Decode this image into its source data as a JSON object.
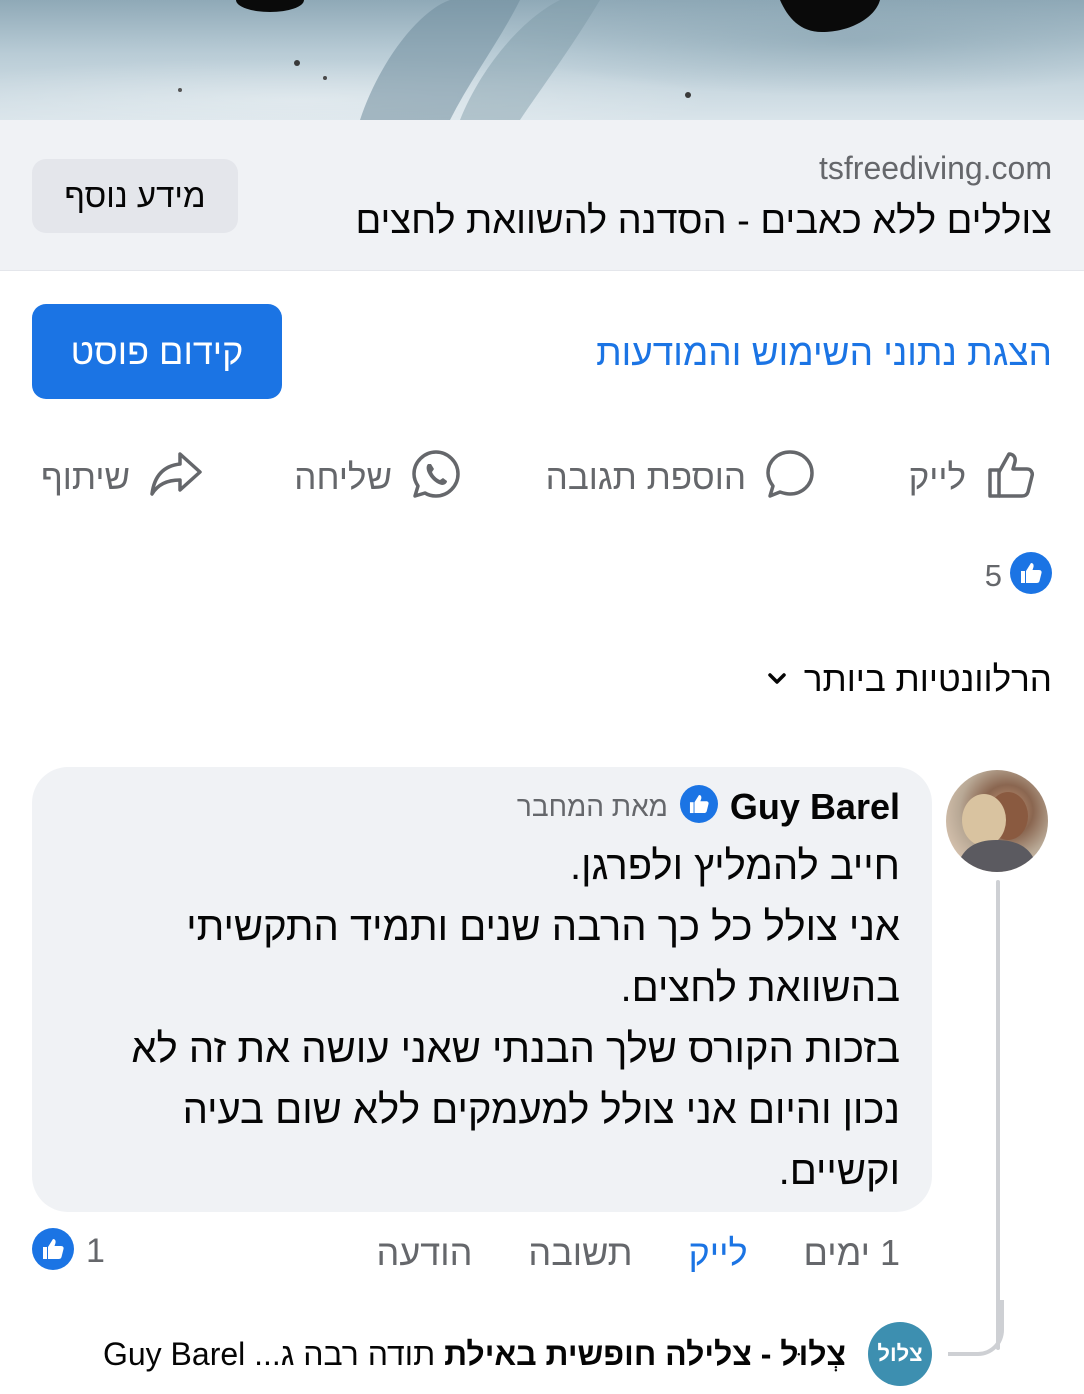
{
  "link_preview": {
    "domain": "tsfreediving.com",
    "title": "צוללים ללא כאבים - הסדנה להשוואת לחצים",
    "more_info_label": "מידע נוסף"
  },
  "promote": {
    "boost_label": "קידום פוסט",
    "insights_label": "הצגת נתוני השימוש והמודעות"
  },
  "actions": {
    "like_label": "לייק",
    "comment_label": "הוספת תגובה",
    "send_label": "שליחה",
    "share_label": "שיתוף"
  },
  "reactions": {
    "count": "5",
    "icon": "like-reaction-icon",
    "color": "#1b74e4"
  },
  "sort": {
    "label": "הרלוונטיות ביותר"
  },
  "comment": {
    "author": "Guy Barel",
    "badge": "מאת המחבר",
    "lines": [
      "חייב להמליץ ולפרגן.",
      "אני צולל כל כך הרבה שנים ותמיד התקשיתי",
      "בהשוואת לחצים.",
      "בזכות הקורס שלך הבנתי שאני עושה את זה לא",
      "נכון והיום אני צולל למעמקים ללא שום בעיה",
      "וקשיים."
    ],
    "time": "1 ימים",
    "like_label": "לייק",
    "reply_label": "תשובה",
    "message_label": "הודעה",
    "reaction_count": "1"
  },
  "reply_preview": {
    "page_name": "צְלוּל - צלילה חופשית באילת",
    "snippet": "תודה רבה ג...",
    "mention": "Guy Barel",
    "avatar_text": "צלול"
  },
  "colors": {
    "accent": "#1b74e4",
    "muted_text": "#65676b",
    "bubble": "#f0f2f5"
  }
}
